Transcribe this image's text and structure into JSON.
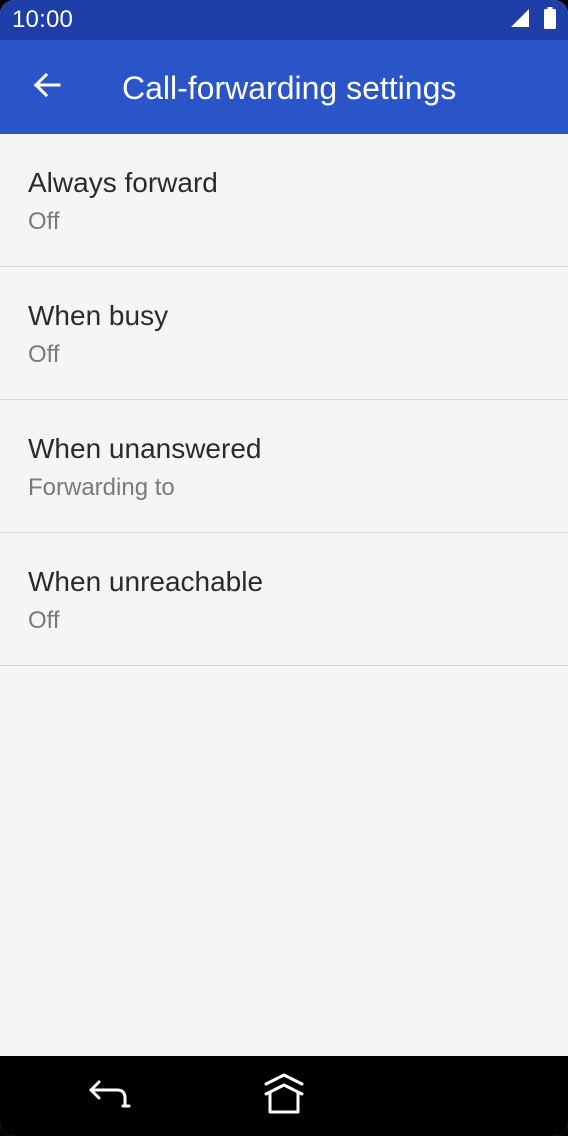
{
  "status_bar": {
    "time": "10:00",
    "icons": [
      "cellular-signal-icon",
      "battery-icon"
    ]
  },
  "app_bar": {
    "back_icon": "arrow-back-icon",
    "title": "Call-forwarding settings",
    "color": "#2a55c9"
  },
  "forwarding_options": [
    {
      "title": "Always forward",
      "summary": "Off"
    },
    {
      "title": "When busy",
      "summary": "Off"
    },
    {
      "title": "When unanswered",
      "summary": "Forwarding to"
    },
    {
      "title": "When unreachable",
      "summary": "Off"
    }
  ],
  "nav_bar": {
    "icons": [
      "back-gesture-icon",
      "home-icon"
    ]
  },
  "colors": {
    "status_bar": "#1e3ea8",
    "app_bar": "#2a55c9",
    "background": "#f5f5f5",
    "title_text": "#2b2b2b",
    "summary_text": "#7a7a7a"
  }
}
